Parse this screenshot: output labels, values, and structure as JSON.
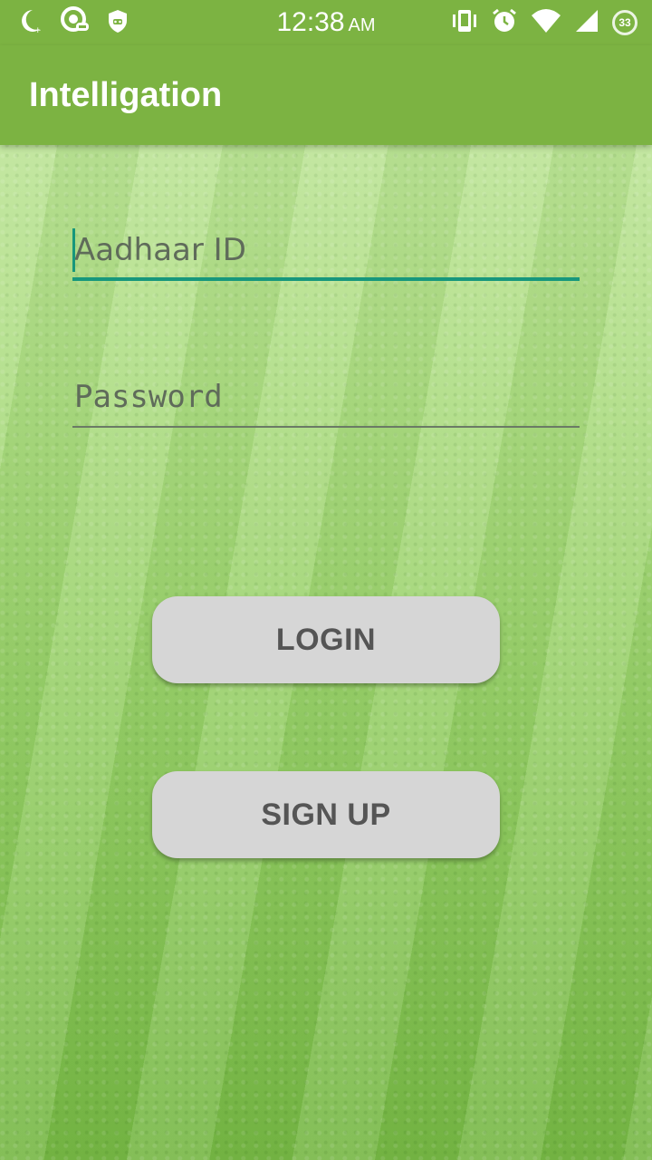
{
  "status_bar": {
    "time": "12:38",
    "ampm": "AM",
    "battery_level": "33",
    "left_icons": [
      "moon-icon",
      "chat-bubble-icon",
      "shield-icon"
    ],
    "right_icons": [
      "vibrate-icon",
      "alarm-icon",
      "wifi-icon",
      "cell-signal-icon",
      "battery-icon"
    ]
  },
  "app_bar": {
    "title": "Intelligation",
    "color": "#7cb342"
  },
  "form": {
    "aadhaar_placeholder": "Aadhaar ID",
    "aadhaar_value": "",
    "password_placeholder": "Password",
    "password_value": "",
    "accent_color": "#17977c"
  },
  "buttons": {
    "login_label": "LOGIN",
    "signup_label": "SIGN UP",
    "color": "#d6d6d6"
  }
}
